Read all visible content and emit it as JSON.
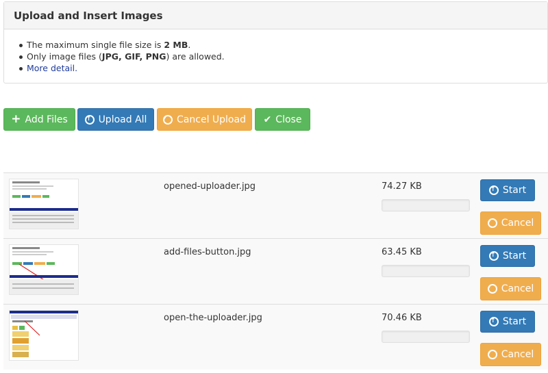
{
  "panel": {
    "title": "Upload and Insert Images",
    "size_prefix": "The maximum single file size is ",
    "size_value": "2 MB",
    "size_suffix": ".",
    "type_prefix": "Only image files (",
    "type_value": "JPG, GIF, PNG",
    "type_suffix": ") are allowed.",
    "more_link": "More detail."
  },
  "toolbar": {
    "add_files": "Add Files",
    "upload_all": "Upload All",
    "cancel_upload": "Cancel Upload",
    "close": "Close"
  },
  "files": [
    {
      "name": "opened-uploader.jpg",
      "size": "74.27 KB",
      "start": "Start",
      "cancel": "Cancel"
    },
    {
      "name": "add-files-button.jpg",
      "size": "63.45 KB",
      "start": "Start",
      "cancel": "Cancel"
    },
    {
      "name": "open-the-uploader.jpg",
      "size": "70.46 KB",
      "start": "Start",
      "cancel": "Cancel"
    }
  ],
  "icons": {
    "add": "plus-icon",
    "upload": "circle-arrow-up-icon",
    "cancel": "ban-icon",
    "close": "check-icon"
  },
  "colors": {
    "success": "#5cb85c",
    "primary": "#337ab7",
    "warning": "#f0ad4e"
  }
}
